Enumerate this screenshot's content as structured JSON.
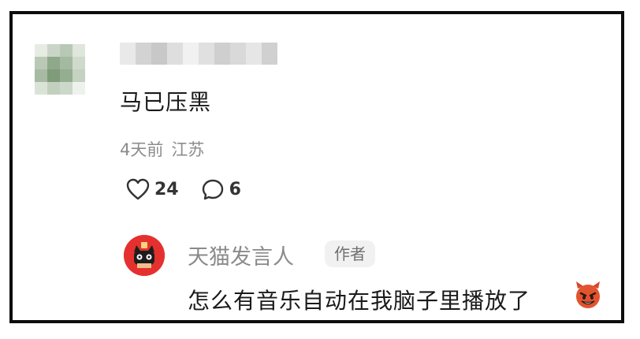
{
  "comment": {
    "text": "马已压黑",
    "time": "4天前",
    "location": "江苏",
    "likes": "24",
    "replies": "6"
  },
  "reply": {
    "author": "天猫发言人",
    "author_tag": "作者",
    "text": "怎么有音乐自动在我脑子里播放了",
    "emoji": "smiling-devil-emoji"
  },
  "icons": {
    "like": "heart-outline-icon",
    "reply": "speech-bubble-icon"
  },
  "colors": {
    "text": "#1a1a1a",
    "meta": "#8c8c8c",
    "brand_red": "#e4312f"
  }
}
